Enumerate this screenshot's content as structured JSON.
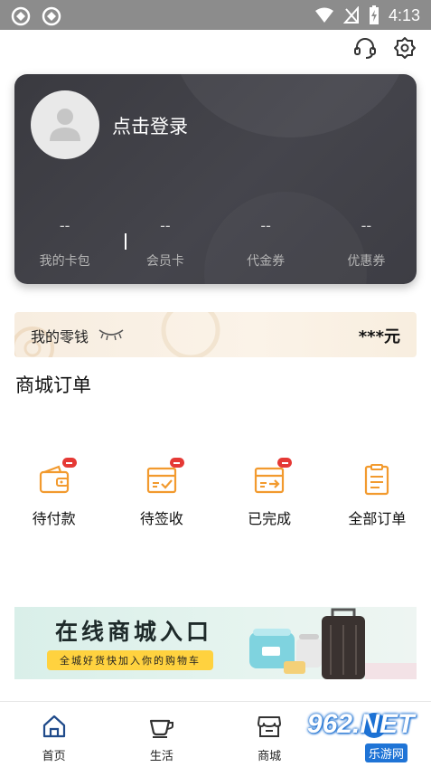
{
  "status_bar": {
    "time": "4:13"
  },
  "profile": {
    "login_text": "点击登录"
  },
  "stats": [
    {
      "value": "--",
      "label": "我的卡包"
    },
    {
      "value": "--",
      "label": "会员卡"
    },
    {
      "value": "--",
      "label": "代金券"
    },
    {
      "value": "--",
      "label": "优惠券"
    }
  ],
  "wallet": {
    "title": "我的零钱",
    "amount": "***元"
  },
  "orders_section": {
    "title": "商城订单",
    "items": [
      {
        "label": "待付款"
      },
      {
        "label": "待签收"
      },
      {
        "label": "已完成"
      },
      {
        "label": "全部订单"
      }
    ]
  },
  "banner": {
    "title": "在线商城入口",
    "subtitle": "全城好货快加入你的购物车"
  },
  "bottom_nav": [
    {
      "label": "首页"
    },
    {
      "label": "生活"
    },
    {
      "label": "商城"
    },
    {
      "label": ""
    }
  ],
  "watermark": {
    "brand": "962.NET",
    "sub": "乐游网"
  },
  "colors": {
    "accent": "#f29a2e",
    "badge": "#e53935",
    "card": "#3f3f46",
    "nav_accent": "#1f74d6"
  }
}
